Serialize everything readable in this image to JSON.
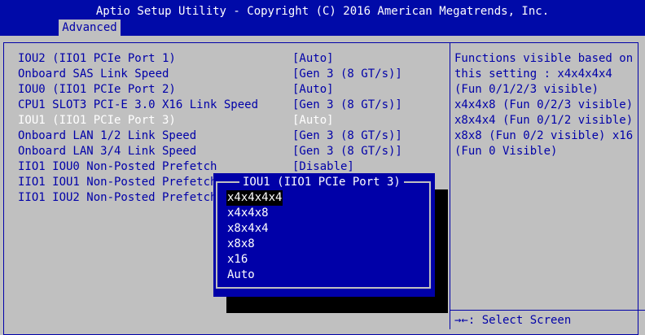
{
  "header": {
    "title": "Aptio Setup Utility - Copyright (C) 2016 American Megatrends, Inc.",
    "tab": "Advanced"
  },
  "settings": [
    {
      "label": "IOU2 (IIO1 PCIe Port 1)",
      "value": "[Auto]"
    },
    {
      "label": "Onboard SAS Link Speed",
      "value": "[Gen 3 (8 GT/s)]"
    },
    {
      "label": "IOU0 (IIO1 PCIe Port 2)",
      "value": "[Auto]"
    },
    {
      "label": "CPU1 SLOT3 PCI-E 3.0 X16 Link Speed",
      "value": "[Gen 3 (8 GT/s)]"
    },
    {
      "label": "IOU1 (IIO1 PCIe Port 3)",
      "value": "[Auto]"
    },
    {
      "label": "Onboard LAN 1/2 Link Speed",
      "value": "[Gen 3 (8 GT/s)]"
    },
    {
      "label": "Onboard LAN 3/4 Link Speed",
      "value": "[Gen 3 (8 GT/s)]"
    },
    {
      "label": "IIO1 IOU0 Non-Posted Prefetch",
      "value": "[Disable]"
    },
    {
      "label": "IIO1 IOU1 Non-Posted Prefetch",
      "value": ""
    },
    {
      "label": "IIO1 IOU2 Non-Posted Prefetch",
      "value": ""
    }
  ],
  "help": [
    "Functions visible based on",
    "this setting : x4x4x4x4",
    "(Fun 0/1/2/3 visible)",
    "x4x4x8 (Fun 0/2/3 visible)",
    "x8x4x4 (Fun 0/1/2 visible)",
    "x8x8 (Fun 0/2 visible) x16",
    "(Fun 0 Visible)"
  ],
  "keys": {
    "select_screen": "→←: Select Screen"
  },
  "popup": {
    "title": "IOU1 (IIO1 PCIe Port 3)",
    "options": [
      "x4x4x4x4",
      "x4x4x8",
      "x8x4x4",
      "x8x8",
      "x16",
      "Auto"
    ]
  },
  "colors": {
    "background": "#c0c0c0",
    "accent": "#0000a8",
    "text_highlight": "#ffffff",
    "shadow": "#000000"
  }
}
